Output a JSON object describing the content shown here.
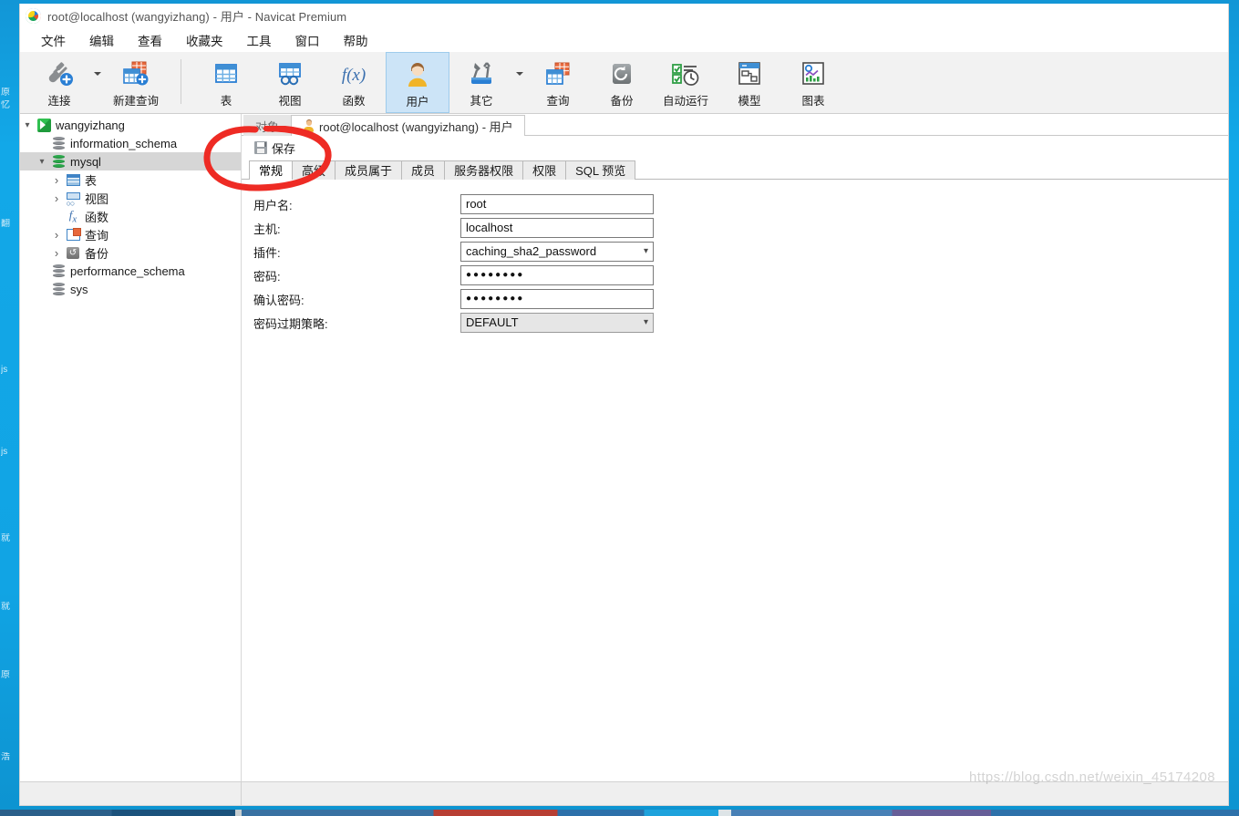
{
  "window": {
    "title": "root@localhost (wangyizhang) - 用户 - Navicat Premium",
    "logo_icon": "navicat-logo-icon"
  },
  "menu": {
    "items": [
      {
        "label": "文件",
        "name": "menu-file"
      },
      {
        "label": "编辑",
        "name": "menu-edit"
      },
      {
        "label": "查看",
        "name": "menu-view"
      },
      {
        "label": "收藏夹",
        "name": "menu-favorites"
      },
      {
        "label": "工具",
        "name": "menu-tools"
      },
      {
        "label": "窗口",
        "name": "menu-window"
      },
      {
        "label": "帮助",
        "name": "menu-help"
      }
    ]
  },
  "ribbon": {
    "buttons": [
      {
        "label": "连接",
        "icon": "connection-icon",
        "active": false,
        "caret": true
      },
      {
        "label": "新建查询",
        "icon": "new-query-icon",
        "active": false,
        "caret": false
      },
      {
        "label": "表",
        "icon": "table-icon",
        "active": false,
        "caret": false
      },
      {
        "label": "视图",
        "icon": "view-icon",
        "active": false,
        "caret": false
      },
      {
        "label": "函数",
        "icon": "function-icon",
        "active": false,
        "caret": false
      },
      {
        "label": "用户",
        "icon": "user-icon",
        "active": true,
        "caret": false
      },
      {
        "label": "其它",
        "icon": "other-tools-icon",
        "active": false,
        "caret": true
      },
      {
        "label": "查询",
        "icon": "query-icon",
        "active": false,
        "caret": false
      },
      {
        "label": "备份",
        "icon": "backup-icon",
        "active": false,
        "caret": false
      },
      {
        "label": "自动运行",
        "icon": "automation-icon",
        "active": false,
        "caret": false
      },
      {
        "label": "模型",
        "icon": "model-icon",
        "active": false,
        "caret": false
      },
      {
        "label": "图表",
        "icon": "chart-icon",
        "active": false,
        "caret": false
      }
    ]
  },
  "sidebar": {
    "nodes": [
      {
        "label": "wangyizhang",
        "icon": "connection-icon",
        "indent": 0,
        "twisty": "open",
        "selected": false
      },
      {
        "label": "information_schema",
        "icon": "database-icon",
        "indent": 1,
        "twisty": "none",
        "selected": false
      },
      {
        "label": "mysql",
        "icon": "database-green-icon",
        "indent": 1,
        "twisty": "open",
        "selected": true
      },
      {
        "label": "表",
        "icon": "table-icon",
        "indent": 2,
        "twisty": "closed",
        "selected": false
      },
      {
        "label": "视图",
        "icon": "view-icon",
        "indent": 2,
        "twisty": "closed",
        "selected": false
      },
      {
        "label": "函数",
        "icon": "function-icon",
        "indent": 2,
        "twisty": "none",
        "selected": false
      },
      {
        "label": "查询",
        "icon": "query-icon",
        "indent": 2,
        "twisty": "closed",
        "selected": false
      },
      {
        "label": "备份",
        "icon": "backup-icon",
        "indent": 2,
        "twisty": "closed",
        "selected": false
      },
      {
        "label": "performance_schema",
        "icon": "database-icon",
        "indent": 1,
        "twisty": "none",
        "selected": false
      },
      {
        "label": "sys",
        "icon": "database-icon",
        "indent": 1,
        "twisty": "none",
        "selected": false
      }
    ]
  },
  "document_tabs": [
    {
      "label": "对象",
      "icon": "none",
      "active": false
    },
    {
      "label": "root@localhost (wangyizhang) - 用户",
      "icon": "user-icon",
      "active": true
    }
  ],
  "toolbar": {
    "save_label": "保存",
    "save_icon": "save-icon"
  },
  "sub_tabs": [
    {
      "label": "常规",
      "active": true
    },
    {
      "label": "高级",
      "active": false
    },
    {
      "label": "成员属于",
      "active": false
    },
    {
      "label": "成员",
      "active": false
    },
    {
      "label": "服务器权限",
      "active": false
    },
    {
      "label": "权限",
      "active": false
    },
    {
      "label": "SQL 预览",
      "active": false
    }
  ],
  "form": {
    "fields": [
      {
        "label": "用户名:",
        "value": "root",
        "type": "text",
        "name": "username-field",
        "disabled": false
      },
      {
        "label": "主机:",
        "value": "localhost",
        "type": "text",
        "name": "host-field",
        "disabled": false
      },
      {
        "label": "插件:",
        "value": "caching_sha2_password",
        "type": "select",
        "name": "plugin-select",
        "disabled": false
      },
      {
        "label": "密码:",
        "value": "●●●●●●●●",
        "type": "password",
        "name": "password-field",
        "disabled": false
      },
      {
        "label": "确认密码:",
        "value": "●●●●●●●●",
        "type": "password",
        "name": "confirm-password-field",
        "disabled": false
      },
      {
        "label": "密码过期策略:",
        "value": "DEFAULT",
        "type": "select",
        "name": "password-expiry-select",
        "disabled": true
      }
    ]
  },
  "annotation": {
    "shape": "red-circle-highlight",
    "color": "#ee2b24"
  },
  "watermark": {
    "text": "https://blog.csdn.net/weixin_45174208"
  },
  "desktop": {
    "top_icon_labels": [
      "",
      "",
      "",
      "",
      "",
      "",
      "",
      "",
      "",
      "",
      ""
    ],
    "left_labels": [
      "原",
      "忆",
      "翻",
      "js",
      "js",
      "就",
      "就",
      "原",
      "浩"
    ]
  },
  "colors": {
    "accent": "#0aa5e8",
    "ribbon_active": "#cce4f7",
    "selection": "#d6d6d6",
    "annotation_red": "#ee2b24"
  }
}
